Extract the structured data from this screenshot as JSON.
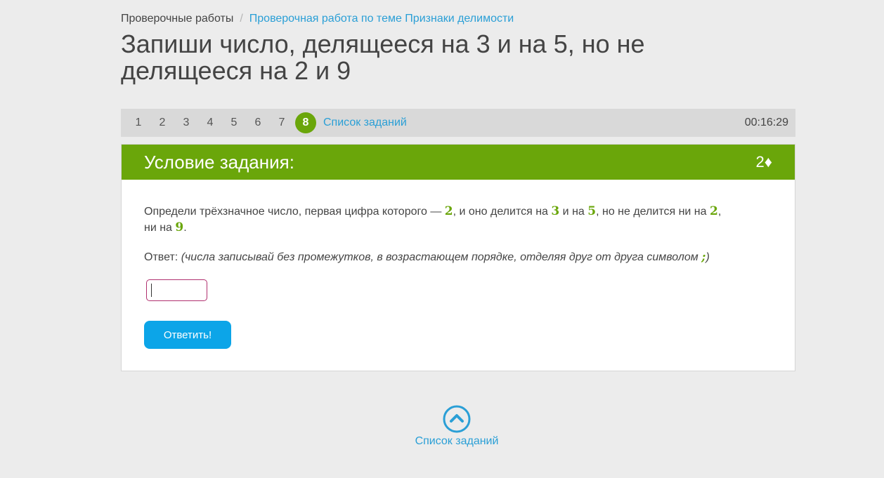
{
  "breadcrumb": {
    "home": "Проверочные работы",
    "separator": "/",
    "current": "Проверочная работа по теме Признаки делимости"
  },
  "title": "Запиши число, делящееся на 3 и на 5, но не делящееся на 2 и 9",
  "nav": {
    "tasks": [
      "1",
      "2",
      "3",
      "4",
      "5",
      "6",
      "7",
      "8"
    ],
    "active": "8",
    "list_link": "Список заданий",
    "timer": "00:16:29"
  },
  "card": {
    "header": "Условие задания:",
    "points": "2♦",
    "task": {
      "t1": "Определи трёхзначное число, первая цифра которого — ",
      "n1": "2",
      "t2": ", и оно делится на ",
      "n2": "3",
      "t3": " и на ",
      "n3": "5",
      "t4": ", но не делится ни на ",
      "n4": "2",
      "t5": ",",
      "t6": "ни на ",
      "n5": "9",
      "t7": "."
    },
    "answer_label": "Ответ:",
    "hint_open": "(числа записывай без промежутков, в возрастающем порядке, отделяя друг от друга символом ",
    "hint_symbol": ";",
    "hint_close": ")",
    "input_value": "",
    "submit_label": "Ответить!"
  },
  "bottom": {
    "icon": "chevron-up-circle-icon",
    "label": "Список заданий"
  },
  "colors": {
    "accent_green": "#6aa60a",
    "link_blue": "#2a9fd6",
    "button_blue": "#0ca5e8",
    "input_border": "#b0306f"
  }
}
